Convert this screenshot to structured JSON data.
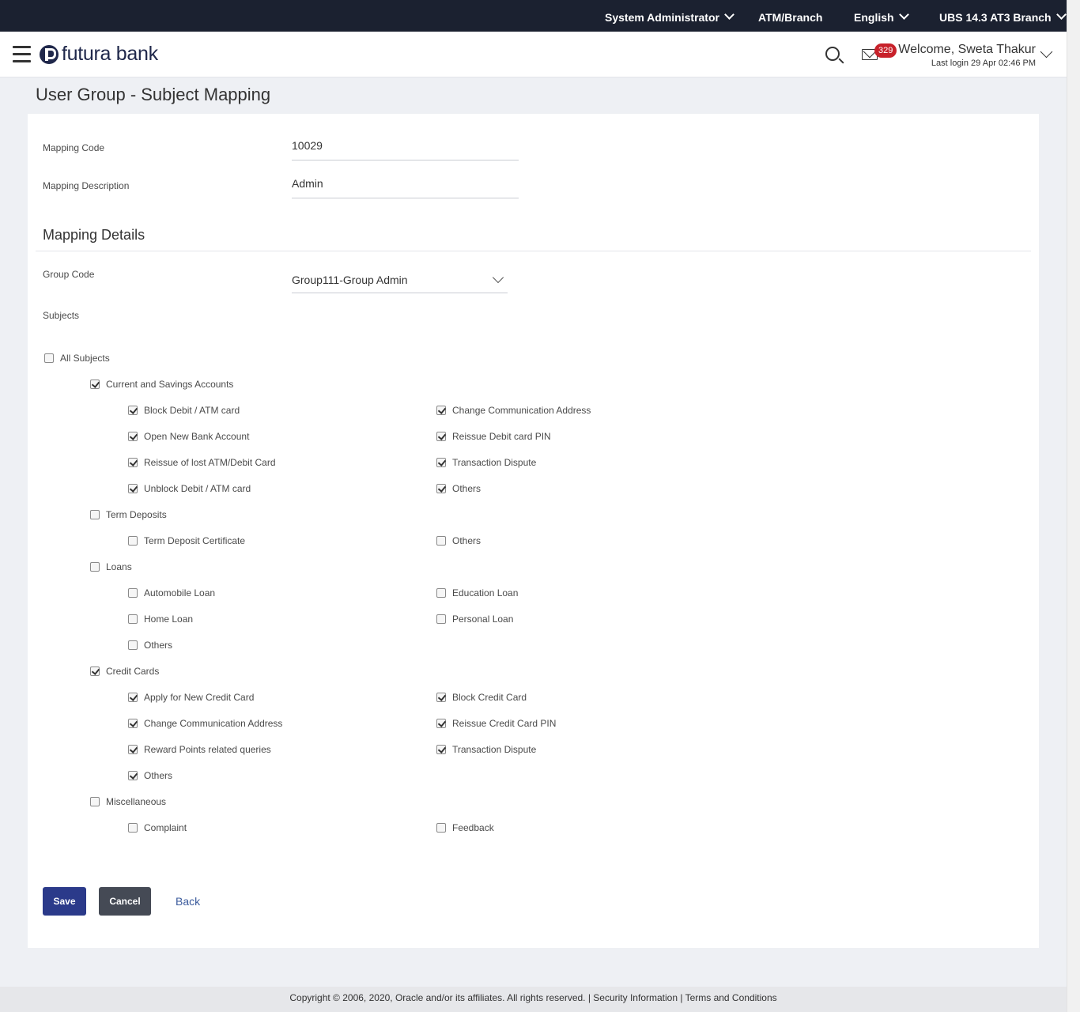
{
  "topbar": {
    "role": "System Administrator",
    "branch_link": "ATM/Branch",
    "language": "English",
    "entity": "UBS 14.3 AT3 Branch"
  },
  "header": {
    "logo_text": "futura bank",
    "notification_count": "329",
    "welcome": "Welcome, Sweta Thakur",
    "last_login": "Last login 29 Apr 02:46 PM"
  },
  "page": {
    "title": "User Group - Subject Mapping"
  },
  "form": {
    "mapping_code_label": "Mapping Code",
    "mapping_code_value": "10029",
    "mapping_description_label": "Mapping Description",
    "mapping_description_value": "Admin",
    "details_title": "Mapping Details",
    "group_code_label": "Group Code",
    "group_code_value": "Group111-Group Admin",
    "subjects_label": "Subjects"
  },
  "subjects": {
    "all": {
      "label": "All Subjects",
      "checked": false
    },
    "categories": [
      {
        "label": "Current and Savings Accounts",
        "checked": true,
        "items": [
          {
            "label": "Block Debit / ATM card",
            "checked": true
          },
          {
            "label": "Change Communication Address",
            "checked": true
          },
          {
            "label": "Open New Bank Account",
            "checked": true
          },
          {
            "label": "Reissue Debit card PIN",
            "checked": true
          },
          {
            "label": "Reissue of lost ATM/Debit Card",
            "checked": true
          },
          {
            "label": "Transaction Dispute",
            "checked": true
          },
          {
            "label": "Unblock Debit / ATM card",
            "checked": true
          },
          {
            "label": "Others",
            "checked": true
          }
        ]
      },
      {
        "label": "Term Deposits",
        "checked": false,
        "items": [
          {
            "label": "Term Deposit Certificate",
            "checked": false
          },
          {
            "label": "Others",
            "checked": false
          }
        ]
      },
      {
        "label": "Loans",
        "checked": false,
        "items": [
          {
            "label": "Automobile Loan",
            "checked": false
          },
          {
            "label": "Education Loan",
            "checked": false
          },
          {
            "label": "Home Loan",
            "checked": false
          },
          {
            "label": "Personal Loan",
            "checked": false
          },
          {
            "label": "Others",
            "checked": false
          }
        ]
      },
      {
        "label": "Credit Cards",
        "checked": true,
        "items": [
          {
            "label": "Apply for New Credit Card",
            "checked": true
          },
          {
            "label": "Block Credit Card",
            "checked": true
          },
          {
            "label": "Change Communication Address",
            "checked": true
          },
          {
            "label": "Reissue Credit Card PIN",
            "checked": true
          },
          {
            "label": "Reward Points related queries",
            "checked": true
          },
          {
            "label": "Transaction Dispute",
            "checked": true
          },
          {
            "label": "Others",
            "checked": true
          }
        ]
      },
      {
        "label": "Miscellaneous",
        "checked": false,
        "items": [
          {
            "label": "Complaint",
            "checked": false
          },
          {
            "label": "Feedback",
            "checked": false
          }
        ]
      }
    ]
  },
  "actions": {
    "save_label": "Save",
    "cancel_label": "Cancel",
    "back_label": "Back"
  },
  "footer": {
    "text": "Copyright © 2006, 2020, Oracle and/or its affiliates. All rights reserved. | Security Information | Terms and Conditions"
  },
  "colors": {
    "topbar_bg": "#1b2130",
    "brand": "#20284b",
    "save_button": "#2b3a8a",
    "cancel_button": "#454a55",
    "badge": "#c8212a",
    "link": "#3a5a9c"
  }
}
